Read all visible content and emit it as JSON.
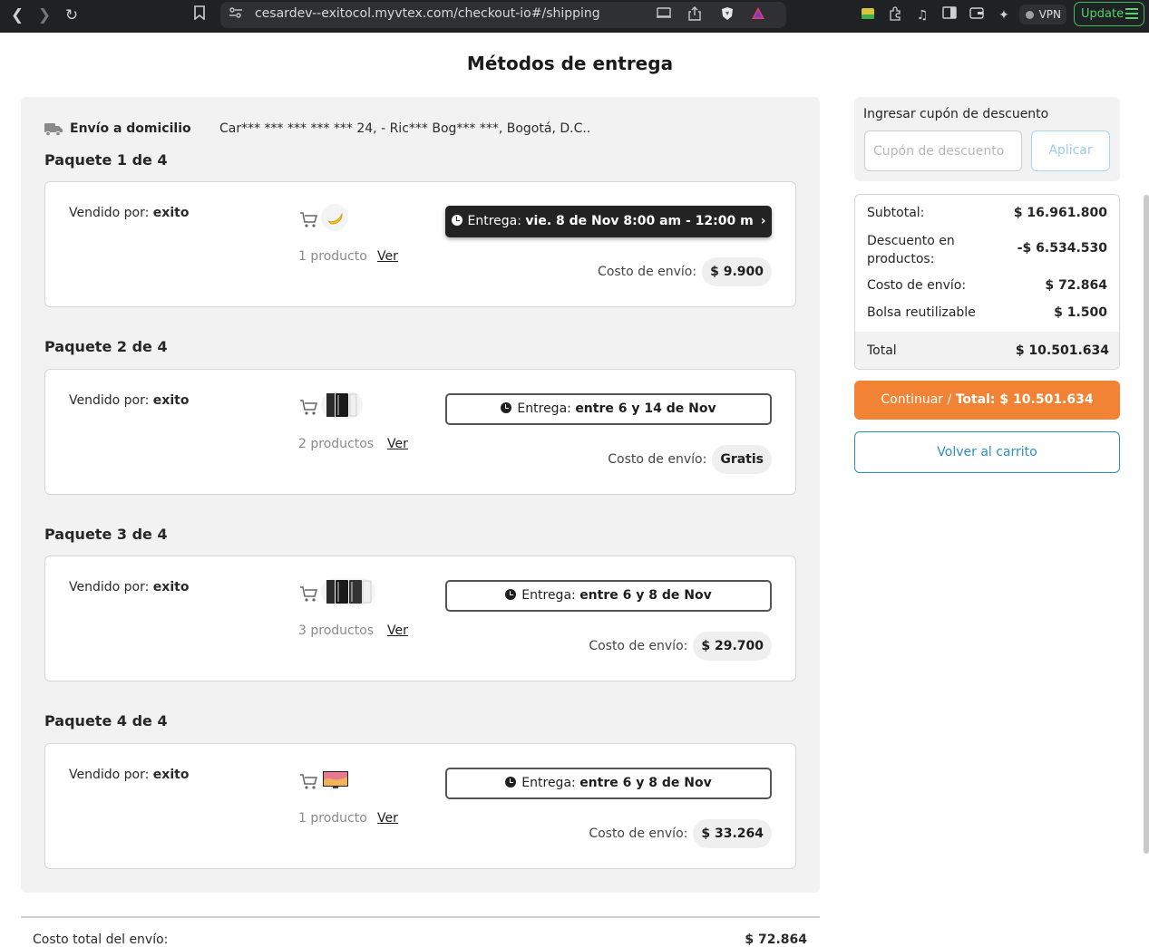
{
  "browser": {
    "url": "cesardev--exitocol.myvtex.com/checkout-io#/shipping",
    "vpn_label": "VPN",
    "update_label": "Update"
  },
  "page": {
    "title": "Métodos de entrega"
  },
  "delivery": {
    "method_label": "Envío a domicilio",
    "address": "Car*** *** *** *** *** 24, - Ric*** Bog*** ***, Bogotá, D.C.."
  },
  "packages": [
    {
      "title": "Paquete 1 de 4",
      "seller_prefix": "Vendido por: ",
      "seller": "exito",
      "product_count": "1 producto",
      "view_label": "Ver",
      "delivery_prefix": "Entrega: ",
      "delivery_window": "vie. 8 de Nov 8:00 am - 12:00 m",
      "shipping_label": "Costo de envío:",
      "shipping_cost": "$ 9.900"
    },
    {
      "title": "Paquete 2 de 4",
      "seller_prefix": "Vendido por: ",
      "seller": "exito",
      "product_count": "2 productos",
      "view_label": "Ver",
      "delivery_prefix": "Entrega: ",
      "delivery_window": "entre 6 y 14 de Nov",
      "shipping_label": "Costo de envío:",
      "shipping_cost": "Gratis"
    },
    {
      "title": "Paquete 3 de 4",
      "seller_prefix": "Vendido por: ",
      "seller": "exito",
      "product_count": "3 productos",
      "view_label": "Ver",
      "delivery_prefix": "Entrega: ",
      "delivery_window": "entre 6 y 8 de Nov",
      "shipping_label": "Costo de envío:",
      "shipping_cost": "$ 29.700"
    },
    {
      "title": "Paquete 4 de 4",
      "seller_prefix": "Vendido por: ",
      "seller": "exito",
      "product_count": "1 producto",
      "view_label": "Ver",
      "delivery_prefix": "Entrega: ",
      "delivery_window": "entre 6 y 8 de Nov",
      "shipping_label": "Costo de envío:",
      "shipping_cost": "$ 33.264"
    }
  ],
  "shipping_total": {
    "label": "Costo total del envío:",
    "value": "$ 72.864"
  },
  "coupon": {
    "label": "Ingresar cupón de descuento",
    "placeholder": "Cupón de descuento",
    "value": "",
    "apply_label": "Aplicar"
  },
  "summary": {
    "subtotal_label": "Subtotal:",
    "subtotal_value": "$ 16.961.800",
    "discount_label": "Descuento en productos:",
    "discount_value": "-$ 6.534.530",
    "shipping_label": "Costo de envío:",
    "shipping_value": "$ 72.864",
    "bag_label": "Bolsa reutilizable",
    "bag_value": "$ 1.500",
    "total_label": "Total",
    "total_value": "$ 10.501.634"
  },
  "actions": {
    "continue_prefix": "Continuar / ",
    "continue_total": "Total: $ 10.501.634",
    "back_label": "Volver al carrito"
  },
  "colors": {
    "accent_orange": "#f28234",
    "link_blue": "#2a8fc2",
    "selected_dark": "#232323",
    "panel_gray": "#f2f2f2"
  }
}
